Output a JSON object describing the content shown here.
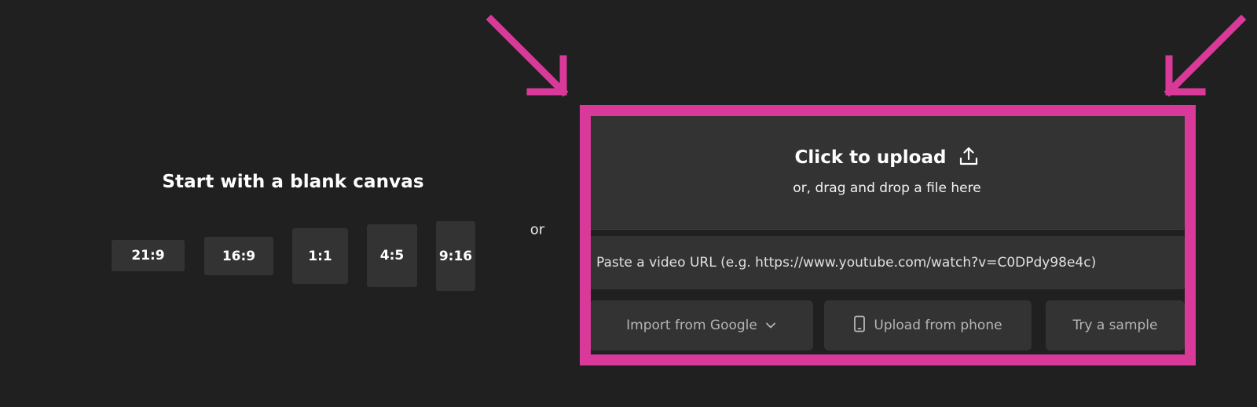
{
  "blank_canvas": {
    "title": "Start with a blank canvas",
    "ratios": [
      "21:9",
      "16:9",
      "1:1",
      "4:5",
      "9:16"
    ]
  },
  "separator": "or",
  "upload": {
    "title": "Click to upload",
    "subtitle": "or, drag and drop a file here",
    "icon": "upload-icon"
  },
  "url_input": {
    "placeholder": "Paste a video URL (e.g. https://www.youtube.com/watch?v=C0DPdy98e4c)",
    "value": ""
  },
  "actions": {
    "import_google": "Import from Google",
    "upload_phone": "Upload from phone",
    "try_sample": "Try a sample"
  },
  "colors": {
    "background": "#202020",
    "surface": "#333333",
    "highlight": "#d93a9a"
  }
}
